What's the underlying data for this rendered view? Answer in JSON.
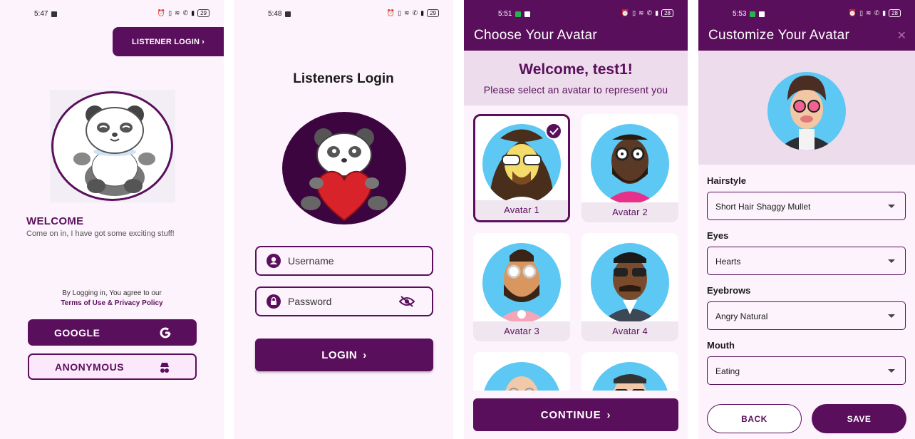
{
  "colors": {
    "primary": "#5a0f5c",
    "background": "#fdf3fc",
    "band": "#ecdcec",
    "avatar_bg": "#5cc8f3"
  },
  "screen1": {
    "time": "5:47",
    "battery": "29",
    "listener_login": "LISTENER LOGIN",
    "welcome_title": "WELCOME",
    "welcome_sub": "Come on in, I have got some exciting stuff!",
    "agree_text": "By Logging in, You agree to our",
    "terms_link": "Terms of Use & Privacy Policy",
    "google_label": "GOOGLE",
    "google_icon": "google-g-icon",
    "anonymous_label": "ANONYMOUS",
    "anonymous_icon": "incognito-icon"
  },
  "screen2": {
    "time": "5:48",
    "battery": "29",
    "title": "Listeners Login",
    "username_placeholder": "Username",
    "password_placeholder": "Password",
    "login_label": "LOGIN"
  },
  "screen3": {
    "time": "5:51",
    "battery": "28",
    "header": "Choose Your Avatar",
    "welcome": "Welcome, test1!",
    "subtitle": "Please select an avatar to represent you",
    "avatars": [
      {
        "label": "Avatar 1",
        "selected": true
      },
      {
        "label": "Avatar 2",
        "selected": false
      },
      {
        "label": "Avatar 3",
        "selected": false
      },
      {
        "label": "Avatar 4",
        "selected": false
      }
    ],
    "continue_label": "CONTINUE"
  },
  "screen4": {
    "time": "5:53",
    "battery": "28",
    "header": "Customize Your Avatar",
    "options": [
      {
        "label": "Hairstyle",
        "value": "Short Hair Shaggy Mullet"
      },
      {
        "label": "Eyes",
        "value": "Hearts"
      },
      {
        "label": "Eyebrows",
        "value": "Angry Natural"
      },
      {
        "label": "Mouth",
        "value": "Eating"
      }
    ],
    "back_label": "BACK",
    "save_label": "SAVE"
  }
}
